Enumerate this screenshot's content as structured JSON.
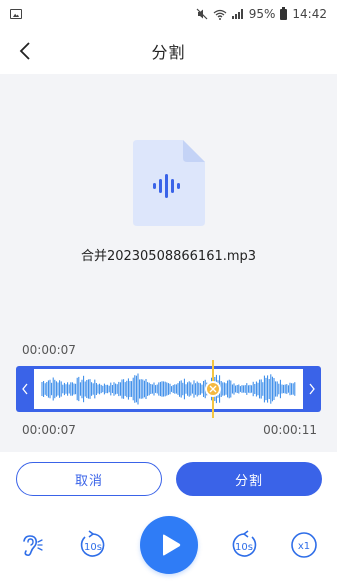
{
  "status_bar": {
    "battery": "95%",
    "time": "14:42",
    "icons": [
      "image-icon",
      "mute-icon",
      "wifi-icon",
      "signal-icon",
      "battery-icon"
    ]
  },
  "header": {
    "title": "分割",
    "back_icon": "chevron-left-icon"
  },
  "file": {
    "icon": "audio-file-icon",
    "name": "合并20230508866161.mp3"
  },
  "timeline": {
    "current_time": "00:00:07",
    "start_time": "00:00:07",
    "end_time": "00:00:11",
    "playhead_fraction": 0.66
  },
  "actions": {
    "cancel_label": "取消",
    "split_label": "分割"
  },
  "controls": {
    "skip_back_label": "10s",
    "skip_forward_label": "10s",
    "speed_label": "x1",
    "icons": [
      "hearing-icon",
      "rewind-10s-icon",
      "play-icon",
      "forward-10s-icon",
      "speed-icon"
    ]
  },
  "colors": {
    "accent": "#3a63e8",
    "play": "#2f7cf6",
    "wave": "#2f86e8",
    "playhead": "#f4c542",
    "panel_bg": "#f3f4f7"
  }
}
